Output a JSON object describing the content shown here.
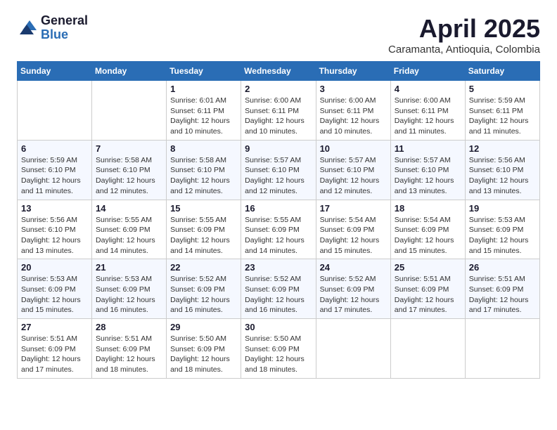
{
  "logo": {
    "general": "General",
    "blue": "Blue"
  },
  "header": {
    "month": "April 2025",
    "location": "Caramanta, Antioquia, Colombia"
  },
  "weekdays": [
    "Sunday",
    "Monday",
    "Tuesday",
    "Wednesday",
    "Thursday",
    "Friday",
    "Saturday"
  ],
  "weeks": [
    [
      {
        "day": "",
        "info": ""
      },
      {
        "day": "",
        "info": ""
      },
      {
        "day": "1",
        "info": "Sunrise: 6:01 AM\nSunset: 6:11 PM\nDaylight: 12 hours\nand 10 minutes."
      },
      {
        "day": "2",
        "info": "Sunrise: 6:00 AM\nSunset: 6:11 PM\nDaylight: 12 hours\nand 10 minutes."
      },
      {
        "day": "3",
        "info": "Sunrise: 6:00 AM\nSunset: 6:11 PM\nDaylight: 12 hours\nand 10 minutes."
      },
      {
        "day": "4",
        "info": "Sunrise: 6:00 AM\nSunset: 6:11 PM\nDaylight: 12 hours\nand 11 minutes."
      },
      {
        "day": "5",
        "info": "Sunrise: 5:59 AM\nSunset: 6:11 PM\nDaylight: 12 hours\nand 11 minutes."
      }
    ],
    [
      {
        "day": "6",
        "info": "Sunrise: 5:59 AM\nSunset: 6:10 PM\nDaylight: 12 hours\nand 11 minutes."
      },
      {
        "day": "7",
        "info": "Sunrise: 5:58 AM\nSunset: 6:10 PM\nDaylight: 12 hours\nand 12 minutes."
      },
      {
        "day": "8",
        "info": "Sunrise: 5:58 AM\nSunset: 6:10 PM\nDaylight: 12 hours\nand 12 minutes."
      },
      {
        "day": "9",
        "info": "Sunrise: 5:57 AM\nSunset: 6:10 PM\nDaylight: 12 hours\nand 12 minutes."
      },
      {
        "day": "10",
        "info": "Sunrise: 5:57 AM\nSunset: 6:10 PM\nDaylight: 12 hours\nand 12 minutes."
      },
      {
        "day": "11",
        "info": "Sunrise: 5:57 AM\nSunset: 6:10 PM\nDaylight: 12 hours\nand 13 minutes."
      },
      {
        "day": "12",
        "info": "Sunrise: 5:56 AM\nSunset: 6:10 PM\nDaylight: 12 hours\nand 13 minutes."
      }
    ],
    [
      {
        "day": "13",
        "info": "Sunrise: 5:56 AM\nSunset: 6:10 PM\nDaylight: 12 hours\nand 13 minutes."
      },
      {
        "day": "14",
        "info": "Sunrise: 5:55 AM\nSunset: 6:09 PM\nDaylight: 12 hours\nand 14 minutes."
      },
      {
        "day": "15",
        "info": "Sunrise: 5:55 AM\nSunset: 6:09 PM\nDaylight: 12 hours\nand 14 minutes."
      },
      {
        "day": "16",
        "info": "Sunrise: 5:55 AM\nSunset: 6:09 PM\nDaylight: 12 hours\nand 14 minutes."
      },
      {
        "day": "17",
        "info": "Sunrise: 5:54 AM\nSunset: 6:09 PM\nDaylight: 12 hours\nand 15 minutes."
      },
      {
        "day": "18",
        "info": "Sunrise: 5:54 AM\nSunset: 6:09 PM\nDaylight: 12 hours\nand 15 minutes."
      },
      {
        "day": "19",
        "info": "Sunrise: 5:53 AM\nSunset: 6:09 PM\nDaylight: 12 hours\nand 15 minutes."
      }
    ],
    [
      {
        "day": "20",
        "info": "Sunrise: 5:53 AM\nSunset: 6:09 PM\nDaylight: 12 hours\nand 15 minutes."
      },
      {
        "day": "21",
        "info": "Sunrise: 5:53 AM\nSunset: 6:09 PM\nDaylight: 12 hours\nand 16 minutes."
      },
      {
        "day": "22",
        "info": "Sunrise: 5:52 AM\nSunset: 6:09 PM\nDaylight: 12 hours\nand 16 minutes."
      },
      {
        "day": "23",
        "info": "Sunrise: 5:52 AM\nSunset: 6:09 PM\nDaylight: 12 hours\nand 16 minutes."
      },
      {
        "day": "24",
        "info": "Sunrise: 5:52 AM\nSunset: 6:09 PM\nDaylight: 12 hours\nand 17 minutes."
      },
      {
        "day": "25",
        "info": "Sunrise: 5:51 AM\nSunset: 6:09 PM\nDaylight: 12 hours\nand 17 minutes."
      },
      {
        "day": "26",
        "info": "Sunrise: 5:51 AM\nSunset: 6:09 PM\nDaylight: 12 hours\nand 17 minutes."
      }
    ],
    [
      {
        "day": "27",
        "info": "Sunrise: 5:51 AM\nSunset: 6:09 PM\nDaylight: 12 hours\nand 17 minutes."
      },
      {
        "day": "28",
        "info": "Sunrise: 5:51 AM\nSunset: 6:09 PM\nDaylight: 12 hours\nand 18 minutes."
      },
      {
        "day": "29",
        "info": "Sunrise: 5:50 AM\nSunset: 6:09 PM\nDaylight: 12 hours\nand 18 minutes."
      },
      {
        "day": "30",
        "info": "Sunrise: 5:50 AM\nSunset: 6:09 PM\nDaylight: 12 hours\nand 18 minutes."
      },
      {
        "day": "",
        "info": ""
      },
      {
        "day": "",
        "info": ""
      },
      {
        "day": "",
        "info": ""
      }
    ]
  ]
}
